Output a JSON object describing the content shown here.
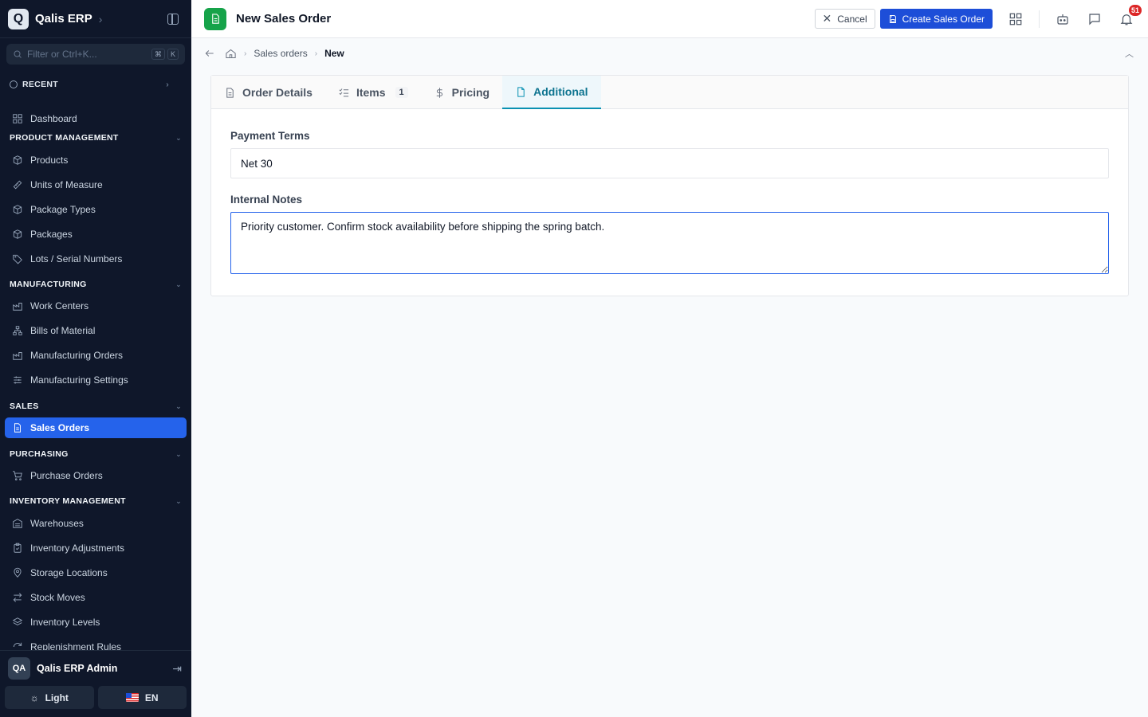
{
  "app": {
    "name": "Qalis ERP",
    "logo_letter": "Q"
  },
  "sidebar": {
    "filter_placeholder": "Filter or Ctrl+K...",
    "kbd": [
      "⌘",
      "K"
    ],
    "recent_label": "RECENT",
    "dashboard": "Dashboard",
    "sections": [
      {
        "title": "PRODUCT MANAGEMENT",
        "items": [
          "Products",
          "Units of Measure",
          "Package Types",
          "Packages",
          "Lots / Serial Numbers"
        ]
      },
      {
        "title": "MANUFACTURING",
        "items": [
          "Work Centers",
          "Bills of Material",
          "Manufacturing Orders",
          "Manufacturing Settings"
        ]
      },
      {
        "title": "SALES",
        "items": [
          "Sales Orders"
        ]
      },
      {
        "title": "PURCHASING",
        "items": [
          "Purchase Orders"
        ]
      },
      {
        "title": "INVENTORY MANAGEMENT",
        "items": [
          "Warehouses",
          "Inventory Adjustments",
          "Storage Locations",
          "Stock Moves",
          "Inventory Levels",
          "Replenishment Rules"
        ]
      }
    ],
    "active_item": "Sales Orders",
    "user": {
      "initials": "QA",
      "name": "Qalis ERP Admin"
    },
    "theme_label": "Light",
    "language_label": "EN"
  },
  "header": {
    "title": "New Sales Order",
    "cancel_label": "Cancel",
    "create_label": "Create Sales Order",
    "notification_count": "51"
  },
  "breadcrumb": {
    "parent": "Sales orders",
    "current": "New"
  },
  "tabs": [
    {
      "label": "Order Details"
    },
    {
      "label": "Items",
      "count": "1"
    },
    {
      "label": "Pricing"
    },
    {
      "label": "Additional"
    }
  ],
  "active_tab": "Additional",
  "form": {
    "payment_terms_label": "Payment Terms",
    "payment_terms_value": "Net 30",
    "internal_notes_label": "Internal Notes",
    "internal_notes_value": "Priority customer. Confirm stock availability before shipping the spring batch."
  }
}
